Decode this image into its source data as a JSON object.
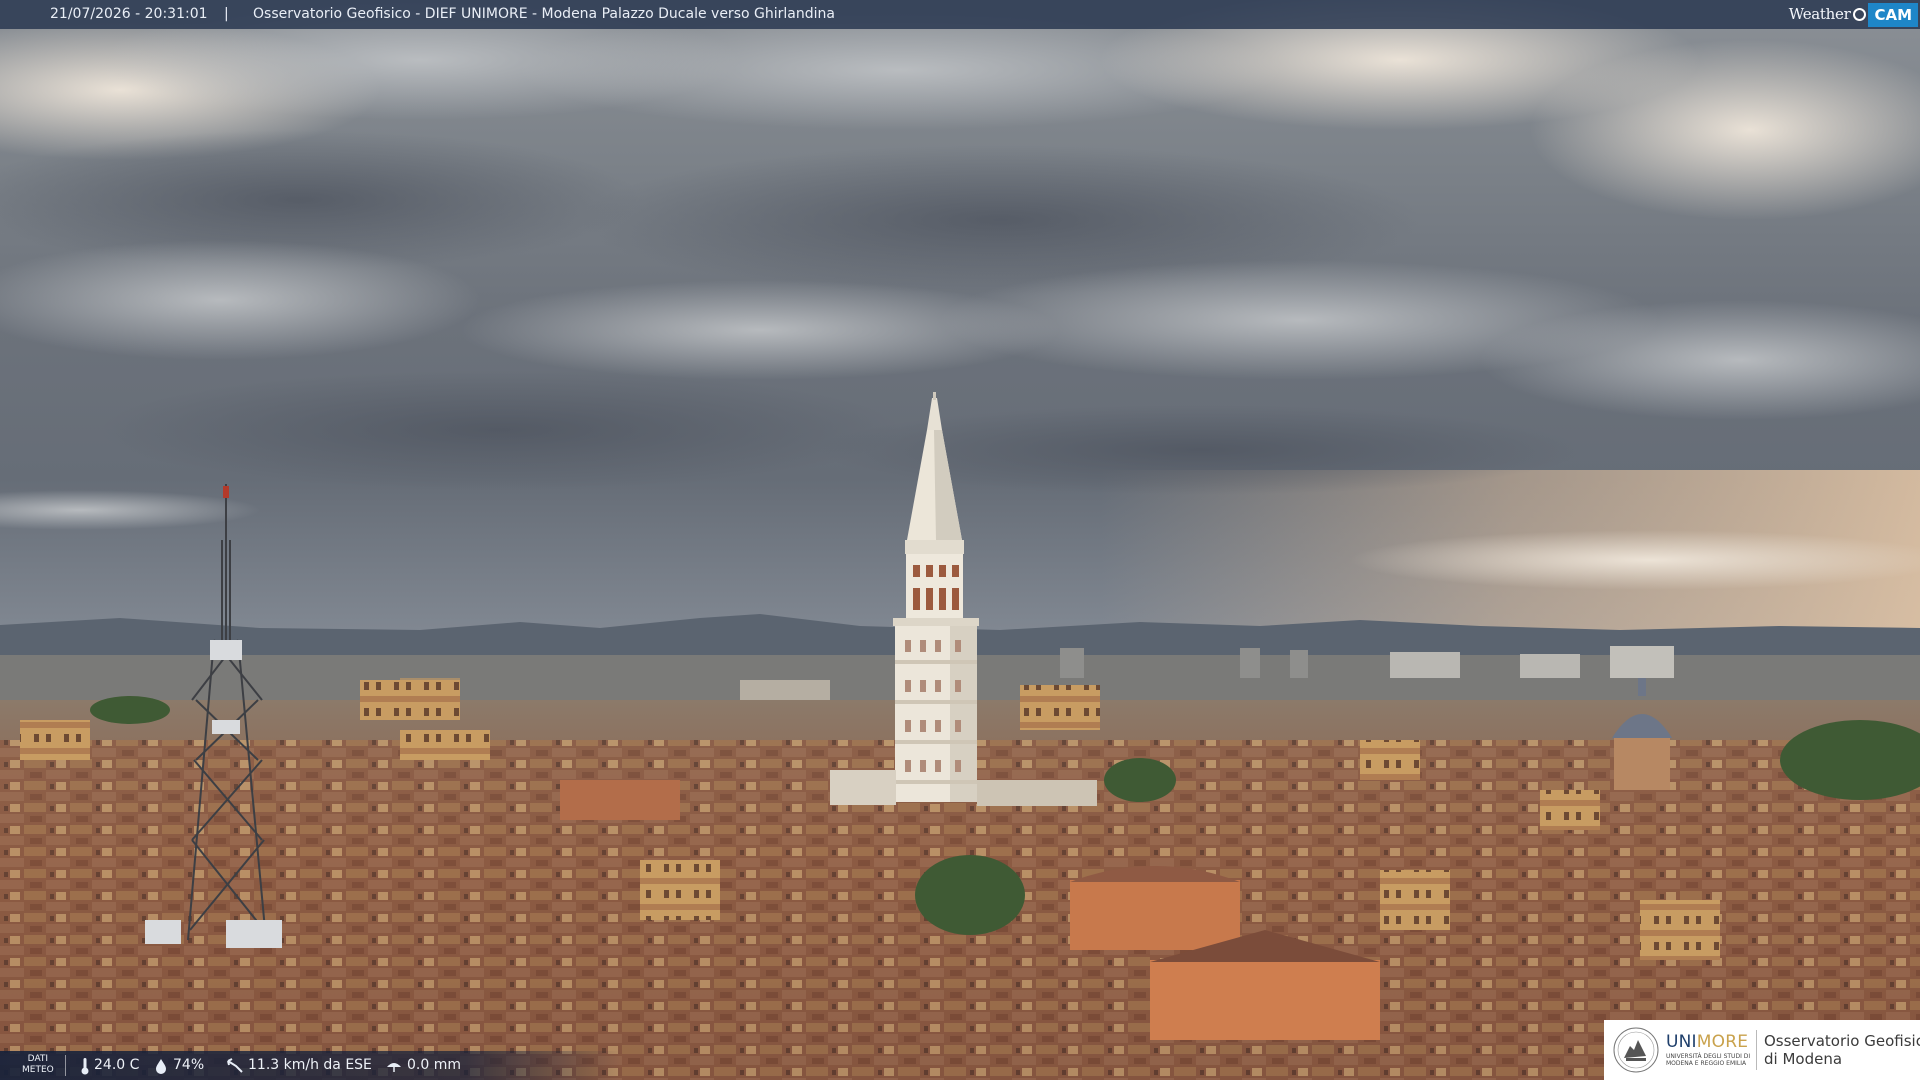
{
  "overlay": {
    "timestamp": "21/07/2026 - 20:31:01",
    "separator": "|",
    "title": "Osservatorio Geofisico - DIEF UNIMORE - Modena Palazzo Ducale verso Ghirlandina",
    "brand_word": "Weather",
    "brand_cam": "CAM"
  },
  "weather": {
    "label_line1": "DATI",
    "label_line2": "METEO",
    "temperature": "24.0 C",
    "humidity": "74%",
    "wind": "11.3 km/h da ESE",
    "rain": "0.0 mm",
    "icons": [
      "thermometer-icon",
      "humidity-drop-icon",
      "wind-icon",
      "rain-icon"
    ]
  },
  "logo": {
    "uni_part1": "UNI",
    "uni_part2": "MORE",
    "university_line1": "UNIVERSITÀ DEGLI STUDI DI",
    "university_line2": "MODENA E REGGIO EMILIA",
    "observatory_line1": "Osservatorio Geofisico",
    "observatory_line2": "di Modena"
  },
  "colors": {
    "topbar": "#26344e",
    "wxbar": "#14203a",
    "brand_blue": "#1e86c8",
    "unimore_blue": "#1f3f6b",
    "unimore_gold": "#c9a24c"
  }
}
